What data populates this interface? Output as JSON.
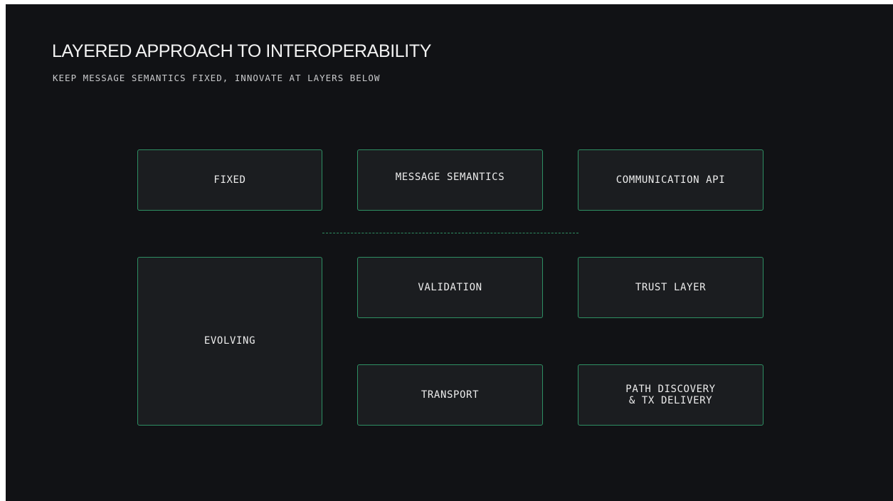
{
  "header": {
    "title": "LAYERED APPROACH TO INTEROPERABILITY",
    "subtitle": "KEEP MESSAGE SEMANTICS FIXED, INNOVATE AT LAYERS BELOW"
  },
  "diagram": {
    "fixed_row": {
      "label": "FIXED",
      "items": [
        "MESSAGE SEMANTICS",
        "COMMUNICATION API"
      ]
    },
    "evolving_row": {
      "label": "EVOLVING",
      "items": [
        "VALIDATION",
        "TRUST LAYER",
        "TRANSPORT",
        "PATH DISCOVERY\n& TX DELIVERY"
      ]
    }
  },
  "colors": {
    "background": "#111215",
    "box_fill": "#1b1d20",
    "accent": "#2e8f63",
    "text": "#ececec"
  }
}
